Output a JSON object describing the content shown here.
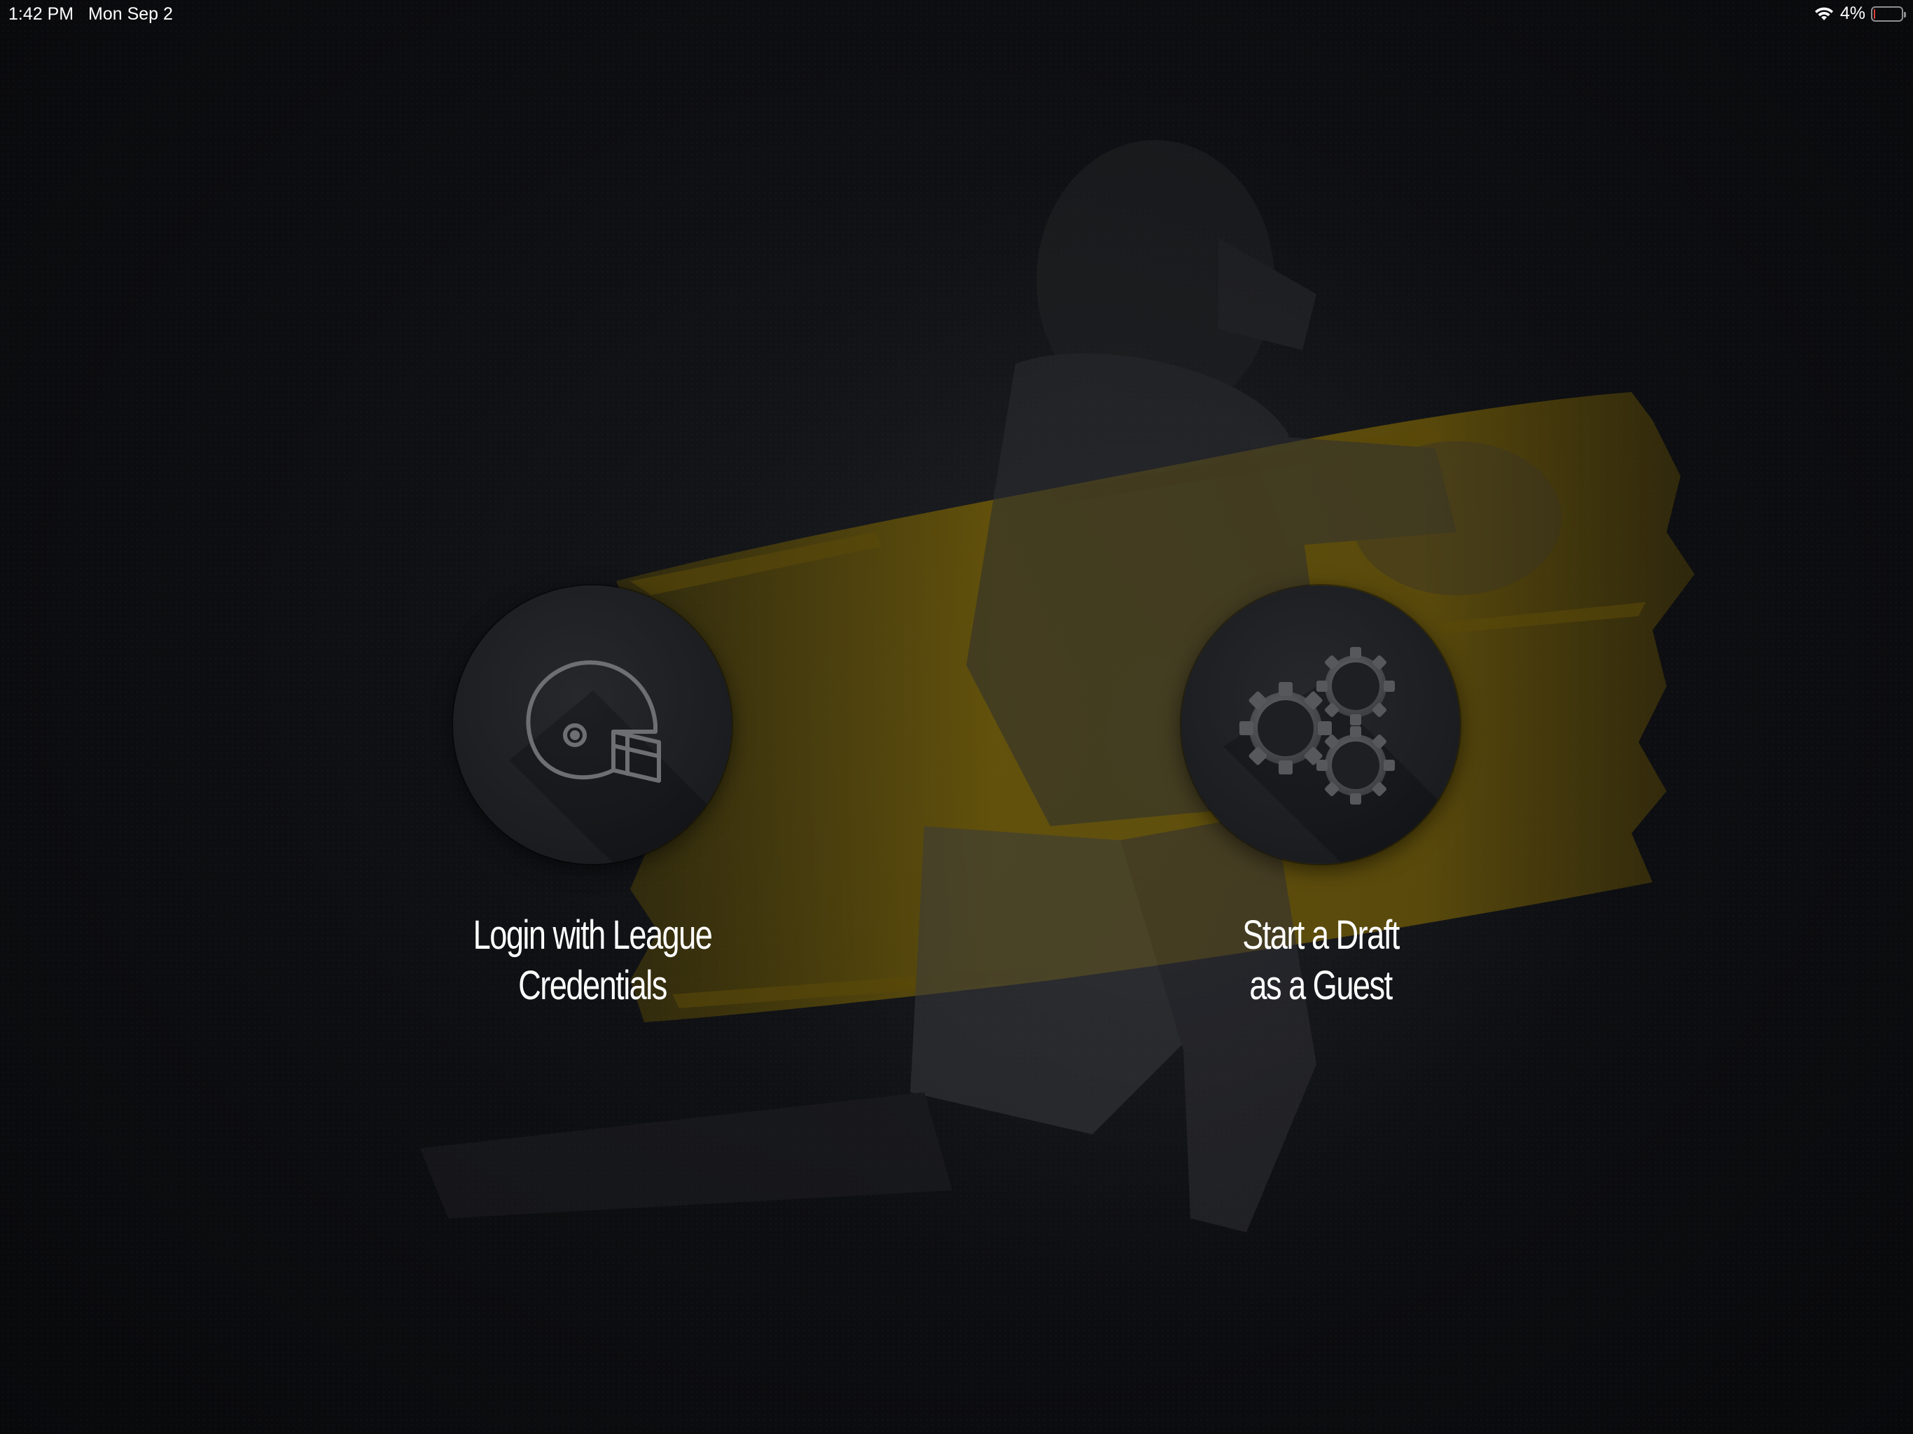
{
  "status_bar": {
    "time": "1:42 PM",
    "date": "Mon Sep 2",
    "battery_percent": "4%",
    "battery_level": 0.04,
    "battery_color": "#e0403a",
    "wifi_icon": "wifi-icon"
  },
  "background": {
    "accent_color": "#6e5a08",
    "artwork": "football-player-photo"
  },
  "actions": {
    "login": {
      "icon": "football-helmet-icon",
      "label_line1": "Login with League",
      "label_line2": "Credentials"
    },
    "guest": {
      "icon": "gears-icon",
      "label_line1": "Start a Draft",
      "label_line2": "as a Guest"
    }
  }
}
